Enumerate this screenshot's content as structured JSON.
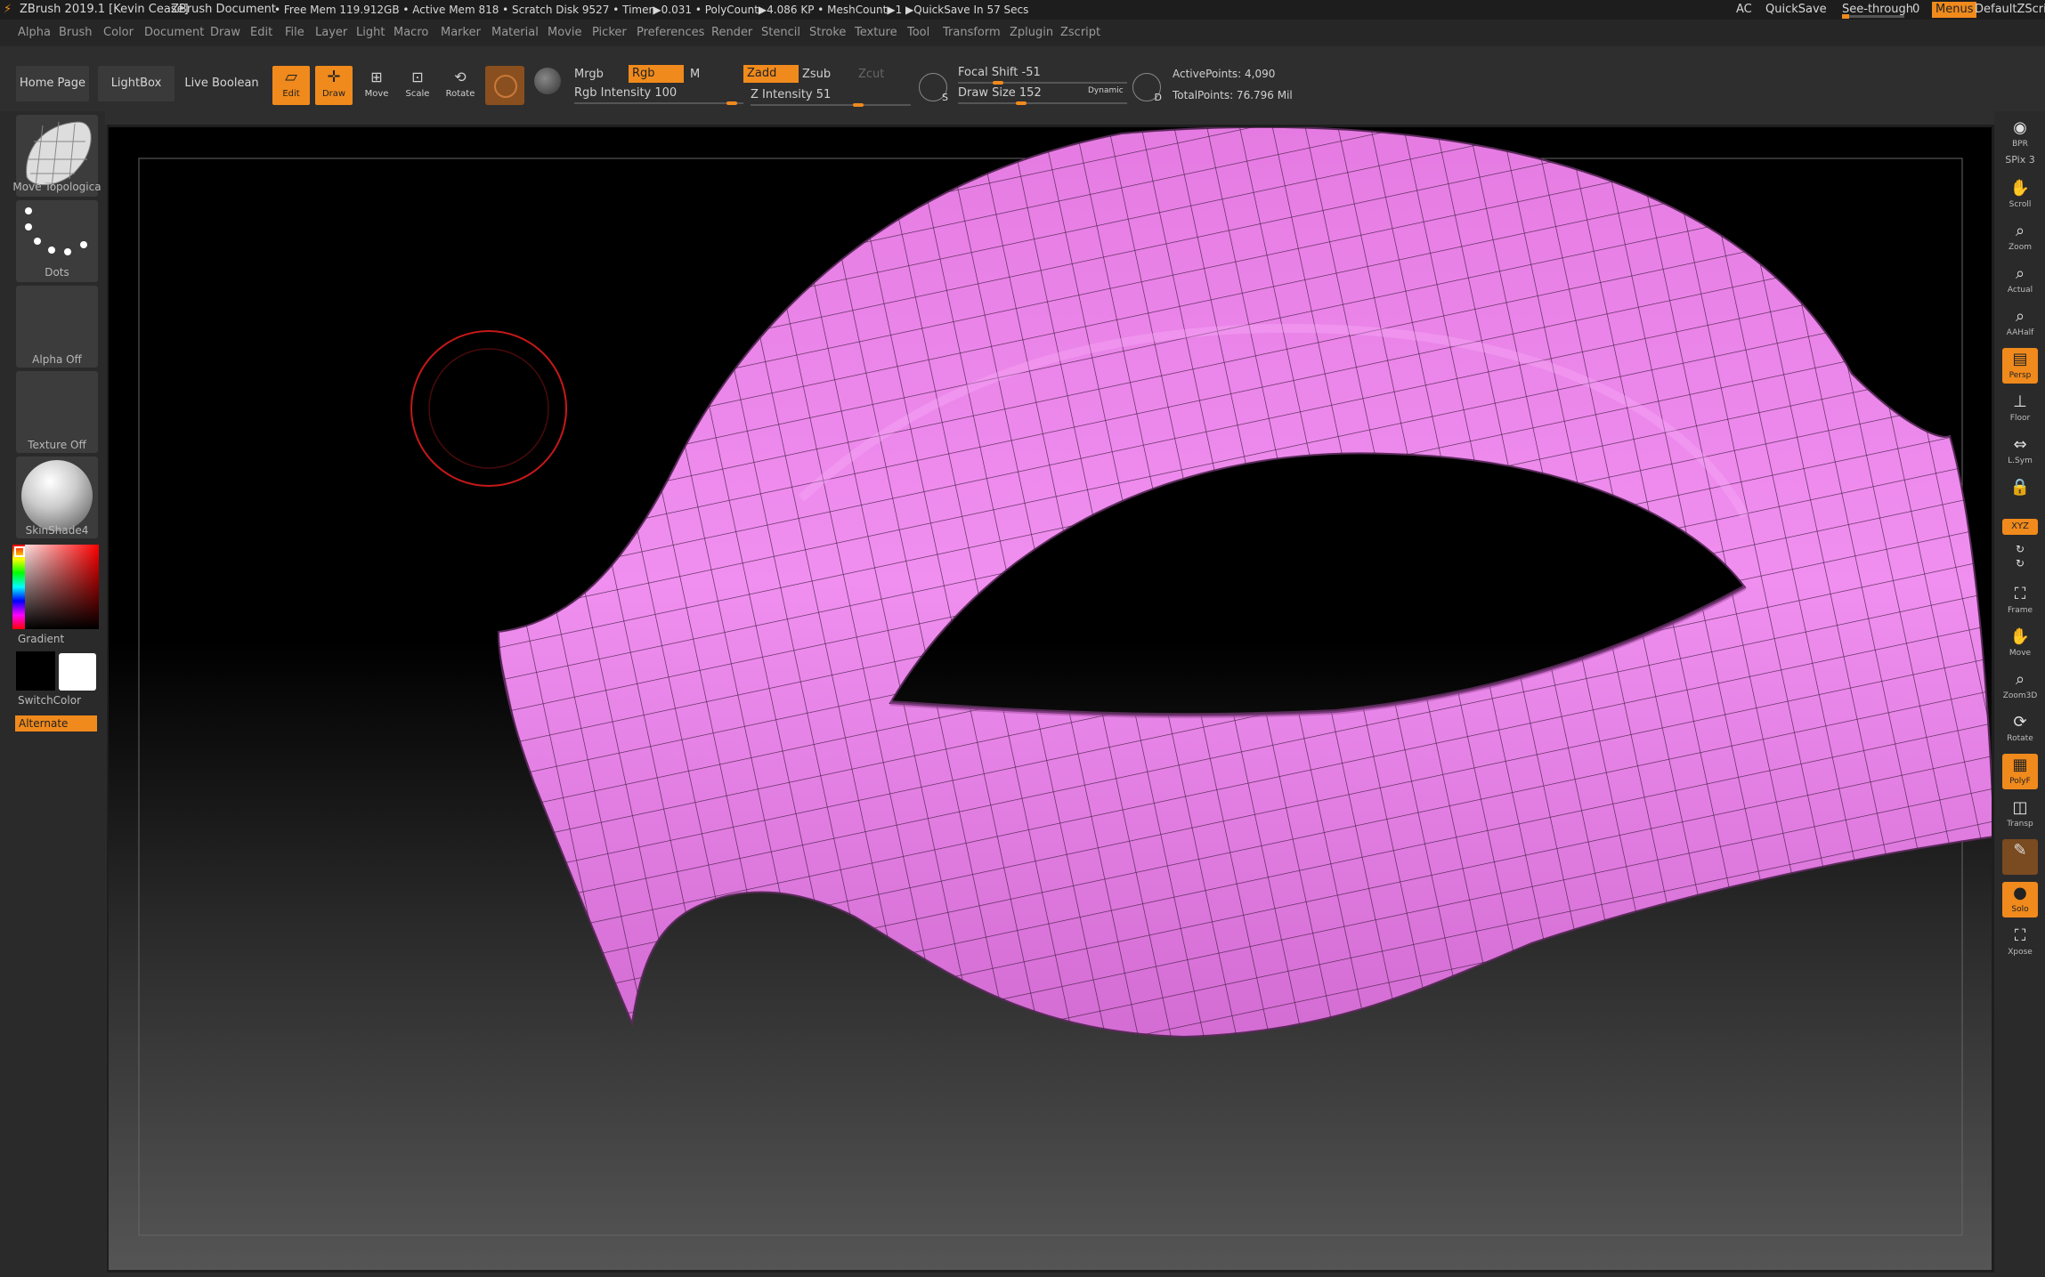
{
  "titlebar": {
    "app": "ZBrush 2019.1 [Kevin Cease]",
    "doc": "ZBrush Document",
    "stats": "• Free Mem 119.912GB • Active Mem 818 • Scratch Disk 9527 • Timer▶0.031 • PolyCount▶4.086 KP • MeshCount▶1 ▶QuickSave In 57 Secs",
    "ac": "AC",
    "quicksave": "QuickSave",
    "seethrough": "See-through",
    "seethrough_val": "0",
    "menus": "Menus",
    "script": "DefaultZScript"
  },
  "menubar": [
    "Alpha",
    "Brush",
    "Color",
    "Document",
    "Draw",
    "Edit",
    "File",
    "Layer",
    "Light",
    "Macro",
    "Marker",
    "Material",
    "Movie",
    "Picker",
    "Preferences",
    "Render",
    "Stencil",
    "Stroke",
    "Texture",
    "Tool",
    "Transform",
    "Zplugin",
    "Zscript"
  ],
  "toolbar": {
    "home": "Home Page",
    "lightbox": "LightBox",
    "liveboolean": "Live Boolean",
    "edit": "Edit",
    "draw": "Draw",
    "move": "Move",
    "scale": "Scale",
    "rotate": "Rotate",
    "mrgb": "Mrgb",
    "rgb": "Rgb",
    "m": "M",
    "rgb_intensity": "Rgb Intensity 100",
    "rgb_intensity_value": 100,
    "zadd": "Zadd",
    "zsub": "Zsub",
    "zcut": "Zcut",
    "z_intensity": "Z Intensity 51",
    "z_intensity_value": 51,
    "focal_shift": "Focal Shift -51",
    "draw_size": "Draw Size 152",
    "dynamic": "Dynamic",
    "active_points": "ActivePoints: 4,090",
    "total_points": "TotalPoints: 76.796 Mil"
  },
  "leftpanel": {
    "brush": "Move Topologica",
    "stroke": "Dots",
    "alpha": "Alpha Off",
    "texture": "Texture Off",
    "material": "SkinShade4",
    "gradient": "Gradient",
    "switchcolor": "SwitchColor",
    "alternate": "Alternate"
  },
  "rightpanel": {
    "bpr": "BPR",
    "spix": "SPix 3",
    "scroll": "Scroll",
    "zoom": "Zoom",
    "actual": "Actual",
    "aahalf": "AAHalf",
    "persp": "Persp",
    "floor": "Floor",
    "lsym": "L.Sym",
    "xyz": "XYZ",
    "frame": "Frame",
    "move": "Move",
    "zoom3d": "Zoom3D",
    "rotate": "Rotate",
    "polyf": "PolyF",
    "transp": "Transp",
    "solo": "Solo",
    "xpose": "Xpose"
  },
  "colors": {
    "accent": "#f08a1c",
    "mesh": "#ee82ee"
  }
}
